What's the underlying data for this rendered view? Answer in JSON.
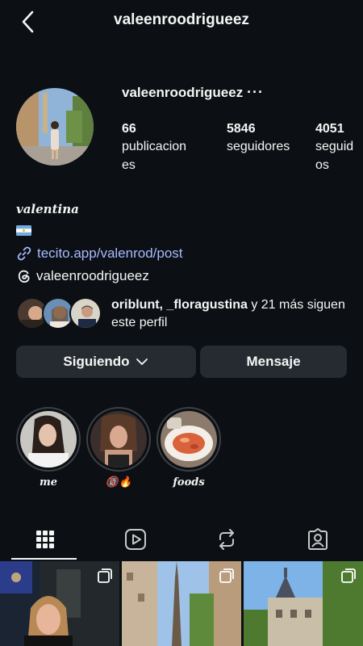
{
  "header": {
    "title": "valeenroodrigueez"
  },
  "profile": {
    "username": "valeenroodrigueez",
    "more": "···",
    "stats": [
      {
        "value": "66",
        "label": "publicaciones"
      },
      {
        "value": "5846",
        "label": "seguidores"
      },
      {
        "value": "4051",
        "label": "seguidos"
      }
    ],
    "name": "valentina",
    "link": "tecito.app/valenrod/post",
    "threads": "valeenroodrigueez"
  },
  "followed_by": {
    "names": "oriblunt, _floragustina",
    "rest": " y 21 más siguen este perfil"
  },
  "buttons": {
    "following": "Siguiendo",
    "message": "Mensaje"
  },
  "highlights": [
    {
      "label": "me"
    },
    {
      "label": "🔞🔥"
    },
    {
      "label": "foods"
    }
  ],
  "colors": {
    "background": "#0c1014",
    "button": "#262b31",
    "link": "#a7b9ff"
  }
}
